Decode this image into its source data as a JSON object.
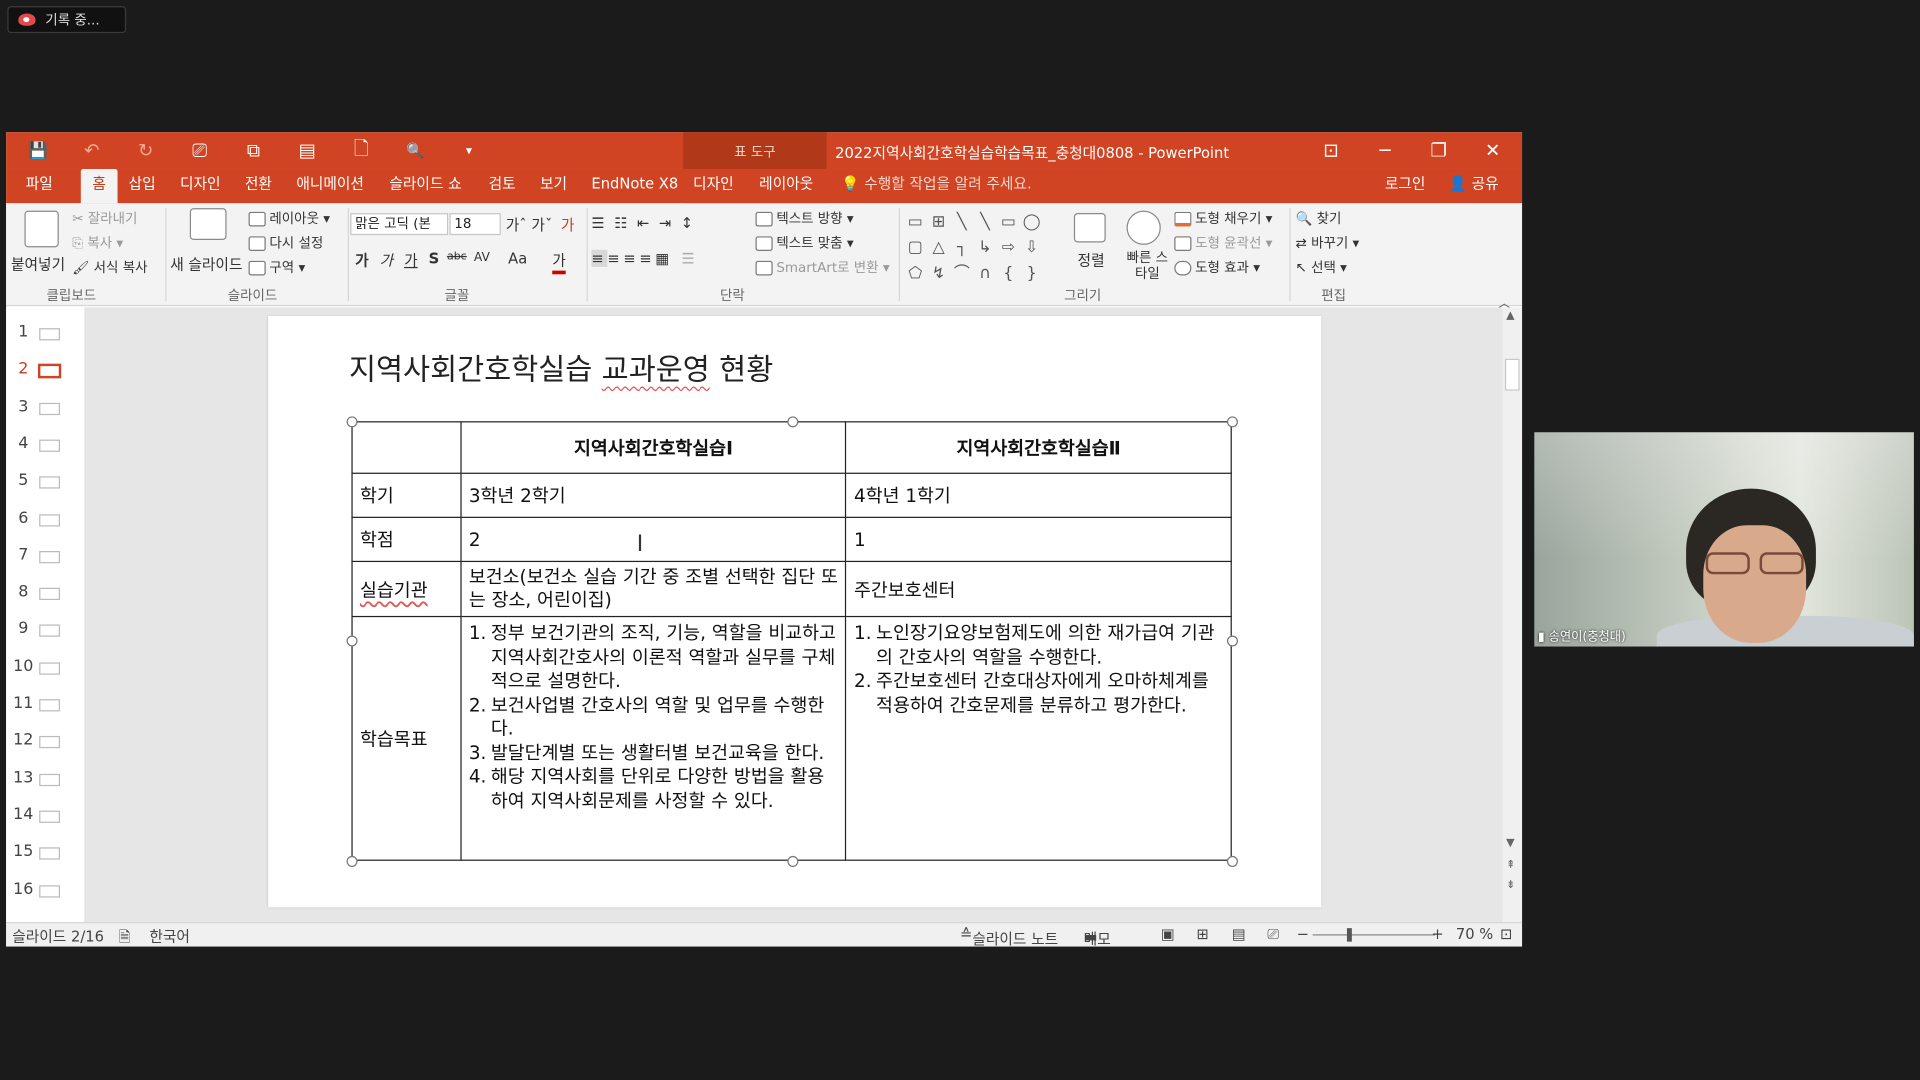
{
  "recording": {
    "label": "기록 중..."
  },
  "window": {
    "title": "2022지역사회간호학실습학습목표_충청대0808 - PowerPoint",
    "context_tab_group": "표 도구",
    "controls": {
      "minimize": "─",
      "restore": "❐",
      "close": "✕",
      "ribbon_display": "⊡"
    }
  },
  "qat": {
    "save": "💾",
    "undo": "↶",
    "undo_arrow": "▾",
    "redo": "↻",
    "present": "⎚",
    "slide": "⧉",
    "layout": "▤",
    "new": "🗋",
    "preview": "🔍",
    "customize": "▾"
  },
  "menu": {
    "tabs": [
      "파일",
      "홈",
      "삽입",
      "디자인",
      "전환",
      "애니메이션",
      "슬라이드 쇼",
      "검토",
      "보기",
      "EndNote X8",
      "디자인",
      "레이아웃"
    ],
    "active_tab": "홈",
    "tell_me": "수행할 작업을 알려 주세요.",
    "login": "로그인",
    "share": "공유"
  },
  "ribbon": {
    "groups": [
      "클립보드",
      "슬라이드",
      "글꼴",
      "단락",
      "그리기",
      "편집"
    ],
    "clipboard": {
      "paste": "붙여넣기",
      "cut": "잘라내기",
      "copy": "복사",
      "format_painter": "서식 복사"
    },
    "slides": {
      "new_slide": "새 슬라이드",
      "layout": "레이아웃",
      "reset": "다시 설정",
      "section": "구역"
    },
    "font": {
      "family": "맑은 고딕 (본",
      "size": "18",
      "grow": "가ˆ",
      "shrink": "가ˇ",
      "clear": "가",
      "bold": "가",
      "italic": "가",
      "underline": "가",
      "shadow": "S",
      "strike": "abc",
      "spacing": "AV",
      "case": "Aa",
      "color": "가"
    },
    "paragraph": {
      "text_direction": "텍스트 방향",
      "align_text": "텍스트 맞춤",
      "smartart": "SmartArt로 변환"
    },
    "drawing": {
      "arrange": "정렬",
      "quick_styles": "빠른 스타일",
      "fill": "도형 채우기",
      "outline": "도형 윤곽선",
      "effects": "도형 효과"
    },
    "editing": {
      "find": "찾기",
      "replace": "바꾸기",
      "select": "선택"
    },
    "shapes": [
      "▭",
      "⊞",
      "╲",
      "╲",
      "▭",
      "◯",
      "▢",
      "△",
      "┐",
      "↳",
      "⇨",
      "⇩",
      "⬠",
      "↯",
      "⌒",
      "∩",
      "{",
      "}"
    ]
  },
  "thumbnails": {
    "count_labels": [
      "1",
      "2",
      "3",
      "4",
      "5",
      "6",
      "7",
      "8",
      "9",
      "10",
      "11",
      "12",
      "13",
      "14",
      "15",
      "16"
    ],
    "selected": "2"
  },
  "slide": {
    "title_part1": "지역사회간호학실습 ",
    "title_part2": "교과운영",
    "title_part3": " 현황",
    "table": {
      "header": [
        "",
        "지역사회간호학실습Ⅰ",
        "지역사회간호학실습Ⅱ"
      ],
      "rows": [
        {
          "label": "학기",
          "c1": "3학년 2학기",
          "c2": "4학년 1학기"
        },
        {
          "label": "학점",
          "c1": "2",
          "c2": "1"
        },
        {
          "label": "실습기관",
          "c1": "보건소(보건소 실습 기간 중 조별 선택한 집단 또는 장소, 어린이집)",
          "c2": "주간보호센터"
        },
        {
          "label": "학습목표",
          "c1_items": [
            {
              "n": "1.",
              "text": "정부 보건기관의 조직, 기능, 역할을 비교하고 지역사회간호사의 이론적 역할과 실무를 구체적으로 설명한다."
            },
            {
              "n": "2.",
              "text": "보건사업별 간호사의 역할 및 업무를 수행한다."
            },
            {
              "n": "3.",
              "text": "발달단계별 또는 생활터별 보건교육을 한다."
            },
            {
              "n": "4.",
              "text": "해당 지역사회를 단위로 다양한 방법을 활용하여 지역사회문제를 사정할 수 있다."
            }
          ],
          "c2_items": [
            {
              "n": "1.",
              "text": "노인장기요양보험제도에 의한 재가급여 기관의 간호사의 역할을 수행한다."
            },
            {
              "n": "2.",
              "text": "주간보호센터 간호대상자에게 오마하체계를 적용하여 간호문제를 분류하고 평가한다."
            }
          ]
        }
      ]
    }
  },
  "statusbar": {
    "slide_info": "슬라이드 2/16",
    "language": "한국어",
    "notes": "슬라이드 노트",
    "comments": "메모",
    "zoom_minus": "−",
    "zoom_plus": "+",
    "zoom": "70 %",
    "zoom_level_percent": 70
  },
  "video": {
    "name": "송연이(충청대)",
    "signal_icon": "signal-bars"
  },
  "colors": {
    "accent": "#d04423",
    "accent_dark": "#b13818",
    "ribbon_bg": "#f3f3f3"
  }
}
